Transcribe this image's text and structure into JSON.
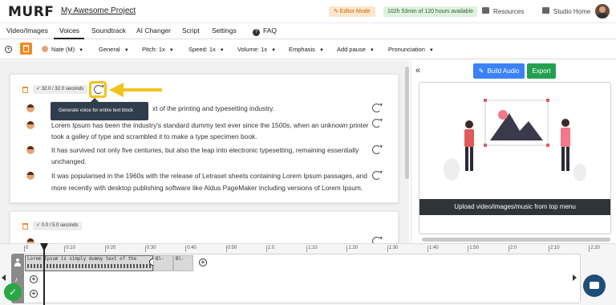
{
  "app": {
    "logo": "MURF",
    "project_name": "My Awesome Project"
  },
  "header": {
    "editor_mode": "✎ Editor Mode",
    "time_available": "102h 53min of 120 hours available",
    "resources": "Resources",
    "studio_home": "Studio Home"
  },
  "tabs": [
    "Video/Images",
    "Voices",
    "Soundtrack",
    "AI Changer",
    "Script",
    "Settings",
    "FAQ"
  ],
  "active_tab": "Voices",
  "toolbar": {
    "voice": "Nate (M)",
    "style": "General",
    "pitch": "Pitch: 1x",
    "speed": "Speed: 1x",
    "volume": "Volume: 1x",
    "emphasis": "Emphasis",
    "add_pause": "Add pause",
    "pronunciation": "Pronunciation"
  },
  "blocks": [
    {
      "duration": "32.0 / 32.0 seconds",
      "tooltip": "Generate voice for entire text block",
      "lines": [
        "xt of the printing and typesetting industry.",
        "Lorem Ipsum has been the industry's standard dummy text ever since the 1500s, when an unknown printer",
        "took a galley of type and scrambled it to make a type specimen book.",
        "It has survived not only five centuries, but also the leap into electronic typesetting, remaining essentially",
        "unchanged.",
        "It was popularised in the 1960s with the release of Letraset sheets containing Lorem Ipsum passages, and",
        "more recently with desktop publishing software like Aldus PageMaker including versions of Lorem Ipsum."
      ]
    },
    {
      "duration": "0.0 / 5.0 seconds"
    }
  ],
  "right_panel": {
    "build_audio": "Build Audio",
    "export": "Export",
    "upload_hint": "Upload video/images/music from top menu"
  },
  "timeline": {
    "ruler": [
      "0",
      "0:10",
      "0:20",
      "0:30",
      "0:40",
      "0:50",
      "1:0",
      "1:10",
      "1:20",
      "1:30",
      "1:40",
      "1:50",
      "2:0",
      "2:10",
      "2:20"
    ],
    "clip_text": "Lorem Ipsum is simply dummy text of the",
    "clip_small_1": "Bl-",
    "clip_small_2": "Bl-"
  },
  "colors": {
    "accent_orange": "#f08a24",
    "highlight_yellow": "#f4c21a",
    "build_blue": "#3b82f6",
    "export_green": "#22a050"
  }
}
